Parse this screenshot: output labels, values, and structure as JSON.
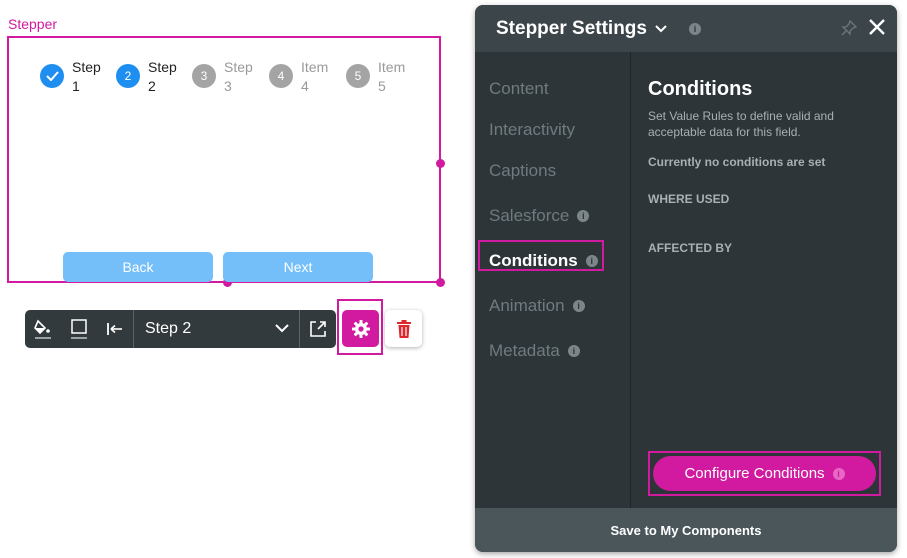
{
  "canvas": {
    "component_label": "Stepper",
    "steps": [
      {
        "number": "",
        "label1": "Step",
        "label2": "1",
        "state": "done"
      },
      {
        "number": "2",
        "label1": "Step",
        "label2": "2",
        "state": "active"
      },
      {
        "number": "3",
        "label1": "Step",
        "label2": "3",
        "state": "todo"
      },
      {
        "number": "4",
        "label1": "Item",
        "label2": "4",
        "state": "todo"
      },
      {
        "number": "5",
        "label1": "Item",
        "label2": "5",
        "state": "todo"
      }
    ],
    "back_label": "Back",
    "next_label": "Next"
  },
  "toolbar": {
    "selected_step": "Step 2",
    "icons": [
      "paint-bucket-icon",
      "border-icon",
      "align-left-icon",
      "chevron-down-icon",
      "open-external-icon",
      "gear-icon",
      "trash-icon"
    ]
  },
  "panel": {
    "title": "Stepper Settings",
    "nav": [
      {
        "label": "Content",
        "info": false,
        "active": false
      },
      {
        "label": "Interactivity",
        "info": false,
        "active": false
      },
      {
        "label": "Captions",
        "info": false,
        "active": false
      },
      {
        "label": "Salesforce",
        "info": true,
        "active": false
      },
      {
        "label": "Conditions",
        "info": true,
        "active": true
      },
      {
        "label": "Animation",
        "info": true,
        "active": false
      },
      {
        "label": "Metadata",
        "info": true,
        "active": false
      }
    ],
    "content": {
      "title": "Conditions",
      "description": "Set Value Rules to define valid and acceptable data for this field.",
      "no_conditions": "Currently no conditions are set",
      "where_used": "WHERE USED",
      "affected_by": "AFFECTED BY"
    },
    "configure_button": "Configure Conditions",
    "footer": "Save to My Components"
  },
  "colors": {
    "accent": "#d11aa0",
    "step_blue": "#1f8ef1",
    "button_blue": "#74bff9",
    "panel_bg": "#2d3538"
  }
}
